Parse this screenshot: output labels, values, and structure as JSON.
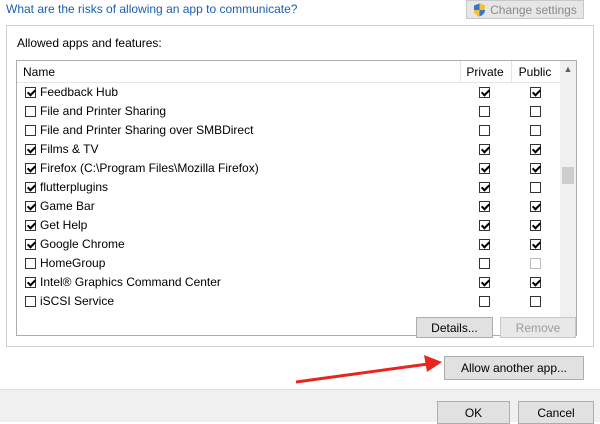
{
  "header": {
    "risk_link": "What are the risks of allowing an app to communicate?",
    "change_settings_label": "Change settings"
  },
  "group": {
    "label": "Allowed apps and features:"
  },
  "columns": {
    "name": "Name",
    "private": "Private",
    "public": "Public"
  },
  "apps": [
    {
      "name": "Feedback Hub",
      "enabled": true,
      "private": true,
      "public": true,
      "public_disabled": false
    },
    {
      "name": "File and Printer Sharing",
      "enabled": false,
      "private": false,
      "public": false,
      "public_disabled": false
    },
    {
      "name": "File and Printer Sharing over SMBDirect",
      "enabled": false,
      "private": false,
      "public": false,
      "public_disabled": false
    },
    {
      "name": "Films & TV",
      "enabled": true,
      "private": true,
      "public": true,
      "public_disabled": false
    },
    {
      "name": "Firefox (C:\\Program Files\\Mozilla Firefox)",
      "enabled": true,
      "private": true,
      "public": true,
      "public_disabled": false
    },
    {
      "name": "flutterplugins",
      "enabled": true,
      "private": true,
      "public": false,
      "public_disabled": false
    },
    {
      "name": "Game Bar",
      "enabled": true,
      "private": true,
      "public": true,
      "public_disabled": false
    },
    {
      "name": "Get Help",
      "enabled": true,
      "private": true,
      "public": true,
      "public_disabled": false
    },
    {
      "name": "Google Chrome",
      "enabled": true,
      "private": true,
      "public": true,
      "public_disabled": false
    },
    {
      "name": "HomeGroup",
      "enabled": false,
      "private": false,
      "public": false,
      "public_disabled": true
    },
    {
      "name": "Intel® Graphics Command Center",
      "enabled": true,
      "private": true,
      "public": true,
      "public_disabled": false
    },
    {
      "name": "iSCSI Service",
      "enabled": false,
      "private": false,
      "public": false,
      "public_disabled": false
    }
  ],
  "buttons": {
    "details": "Details...",
    "remove": "Remove",
    "allow_another": "Allow another app...",
    "ok": "OK",
    "cancel": "Cancel"
  },
  "colors": {
    "link": "#1a5fb4",
    "annotation_arrow": "#e8261f"
  },
  "icons": {
    "shield": "uac-shield-icon",
    "scroll_up": "chevron-up-icon",
    "scroll_down": "chevron-down-icon"
  }
}
